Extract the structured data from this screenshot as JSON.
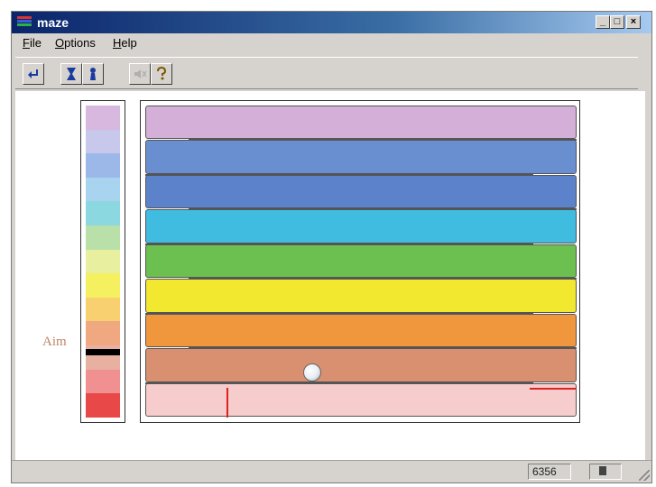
{
  "window": {
    "title": "maze",
    "controls": {
      "minimize": "_",
      "maximize": "□",
      "close": "×"
    }
  },
  "menu": [
    {
      "label": "File",
      "u": "F",
      "rest": "ile"
    },
    {
      "label": "Options",
      "u": "O",
      "rest": "ptions"
    },
    {
      "label": "Help",
      "u": "H",
      "rest": "elp"
    }
  ],
  "toolbar": {
    "icons": [
      "return-arrow-icon",
      "hourglass-icon",
      "pawn-icon",
      "speaker-muted-icon",
      "help-question-icon"
    ]
  },
  "scale": {
    "label": "Aim",
    "colors": [
      "#d9b8e0",
      "#c8c8ec",
      "#9cb8e8",
      "#a8d4f0",
      "#8cd8e0",
      "#b8e0a8",
      "#e8f0a0",
      "#f4f060",
      "#f8d070",
      "#f0a880",
      "#e8b0a0",
      "#f09090",
      "#e84848"
    ],
    "aim_level": 0.78
  },
  "maze": {
    "bands": [
      "#d4b0d8",
      "#6a8fd0",
      "#5d82cc",
      "#3fbce0",
      "#6cc050",
      "#f2e830",
      "#f0963c",
      "#d89070",
      "#f6cccc"
    ]
  },
  "status": {
    "count": "6356"
  },
  "colors": {
    "accent": "#0a246a",
    "aim_text": "#c0856a"
  }
}
